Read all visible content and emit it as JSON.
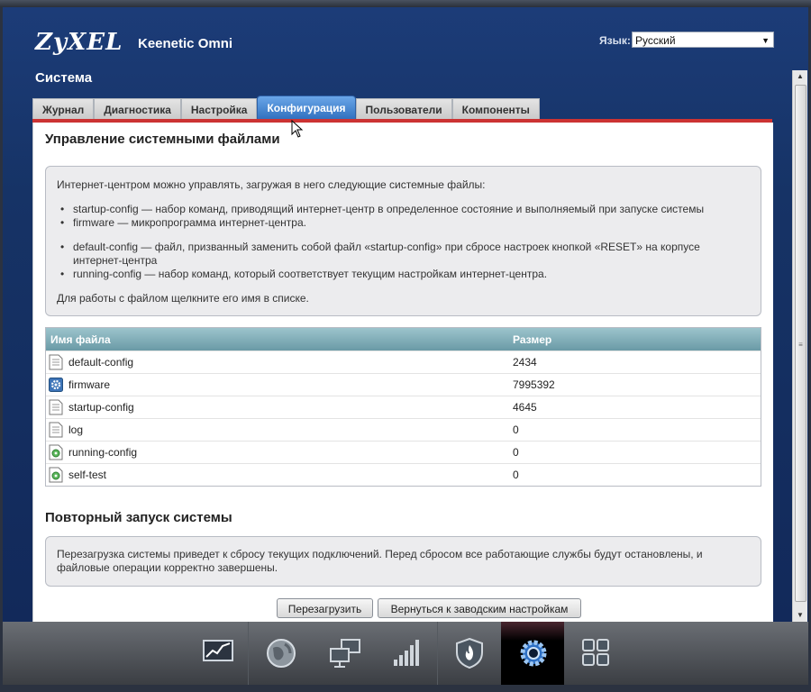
{
  "header": {
    "logo": "ZyXEL",
    "model": "Keenetic Omni",
    "lang_label": "Язык:",
    "lang_value": "Русский",
    "section": "Система"
  },
  "tabs": [
    {
      "label": "Журнал"
    },
    {
      "label": "Диагностика"
    },
    {
      "label": "Настройка"
    },
    {
      "label": "Конфигурация"
    },
    {
      "label": "Пользователи"
    },
    {
      "label": "Компоненты"
    }
  ],
  "files_section": {
    "title": "Управление системными файлами",
    "intro": "Интернет-центром можно управлять, загружая в него следующие системные файлы:",
    "items": [
      "startup-config — набор команд, приводящий интернет-центр в определенное состояние и выполняемый при запуске системы",
      "firmware — микропрограмма интернет-центра.",
      "default-config — файл, призванный заменить собой файл «startup-config» при сбросе настроек кнопкой «RESET» на корпусе интернет-центра",
      "running-config — набор команд, который соответствует текущим настройкам интернет-центра."
    ],
    "hint": "Для работы с файлом щелкните его имя в списке."
  },
  "table": {
    "col_name": "Имя файла",
    "col_size": "Размер",
    "rows": [
      {
        "name": "default-config",
        "size": "2434",
        "icon": "document-icon"
      },
      {
        "name": "firmware",
        "size": "7995392",
        "icon": "gear-icon"
      },
      {
        "name": "startup-config",
        "size": "4645",
        "icon": "document-icon"
      },
      {
        "name": "log",
        "size": "0",
        "icon": "document-icon"
      },
      {
        "name": "running-config",
        "size": "0",
        "icon": "document-gear-icon"
      },
      {
        "name": "self-test",
        "size": "0",
        "icon": "document-gear-icon"
      }
    ]
  },
  "restart_section": {
    "title": "Повторный запуск системы",
    "text": "Перезагрузка системы приведет к сбросу текущих подключений. Перед сбросом все работающие службы будут остановлены, и файловые операции корректно завершены.",
    "reboot_button": "Перезагрузить",
    "reset_button": "Вернуться к заводским настройкам"
  },
  "dock": [
    {
      "icon": "monitor-chart-icon"
    },
    {
      "icon": "globe-icon"
    },
    {
      "icon": "network-computers-icon"
    },
    {
      "icon": "signal-bars-icon"
    },
    {
      "icon": "shield-flame-icon"
    },
    {
      "icon": "gear-icon",
      "active": true
    },
    {
      "icon": "apps-grid-icon"
    }
  ],
  "colors": {
    "header_bg": "#163366",
    "active_tab": "#2f6fbe",
    "tab_accent": "#cc3333",
    "table_header": "#6a9aa6"
  }
}
